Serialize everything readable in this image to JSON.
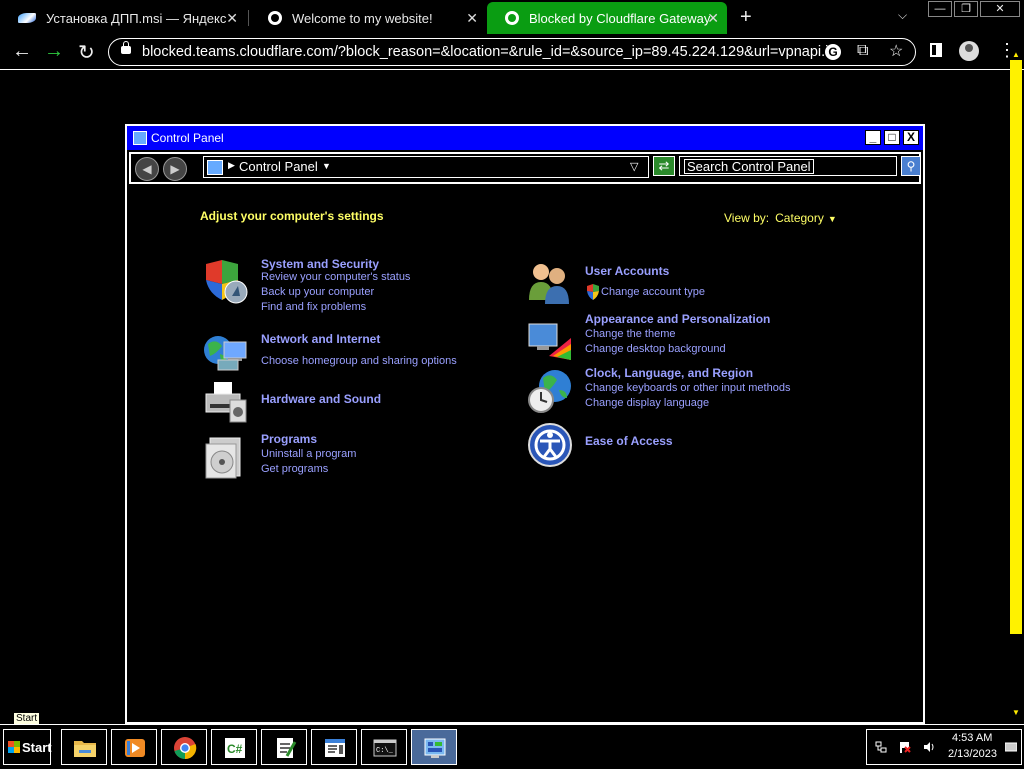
{
  "browser": {
    "tabs": [
      {
        "title": "Установка ДПП.msi — Яндекс.Д",
        "icon": "yandex-disk-icon",
        "active": false
      },
      {
        "title": "Welcome to my website!",
        "icon": "globe-icon",
        "active": false
      },
      {
        "title": "Blocked by Cloudflare Gateway",
        "icon": "globe-icon",
        "active": true
      }
    ],
    "new_tab": "+",
    "tab_close": "✕",
    "window_controls": {
      "minimize": "—",
      "restore": "❐",
      "close": "✕"
    },
    "url": "blocked.teams.cloudflare.com/?block_reason=&location=&rule_id=&source_ip=89.45.224.129&url=vpnapi.io",
    "google_letter": "G",
    "accent_active_tab": "#0a9d12"
  },
  "control_panel": {
    "window_title": "Control Panel",
    "window_buttons": {
      "minimize": "_",
      "maximize": "□",
      "close": "X"
    },
    "breadcrumb": "Control Panel",
    "search_placeholder": "Search Control Panel",
    "heading": "Adjust your computer's settings",
    "view_by_label": "View by:",
    "view_by_value": "Category",
    "categories": [
      {
        "title": "System and Security",
        "icon": "shield-icon",
        "links": [
          "Review your computer's status",
          "Back up your computer",
          "Find and fix problems"
        ]
      },
      {
        "title": "Network and Internet",
        "icon": "network-globe-icon",
        "links": [
          "Choose homegroup and sharing options"
        ]
      },
      {
        "title": "Hardware and Sound",
        "icon": "printer-icon",
        "links": []
      },
      {
        "title": "Programs",
        "icon": "programs-icon",
        "links": [
          "Uninstall a program",
          "Get programs"
        ]
      },
      {
        "title": "User Accounts",
        "icon": "users-icon",
        "links": [
          "Change account type"
        ]
      },
      {
        "title": "Appearance and Personalization",
        "icon": "monitor-palette-icon",
        "links": [
          "Change the theme",
          "Change desktop background"
        ]
      },
      {
        "title": "Clock, Language, and Region",
        "icon": "clock-globe-icon",
        "links": [
          "Change keyboards or other input methods",
          "Change display language"
        ]
      },
      {
        "title": "Ease of Access",
        "icon": "ease-of-access-icon",
        "links": []
      }
    ],
    "heading_color": "#ffff66",
    "link_color": "#9aa0ff",
    "title_bar_color": "#0000ff"
  },
  "taskbar": {
    "start_label": "Start",
    "start_tooltip": "Start",
    "pinned": [
      "file-explorer-icon",
      "media-player-icon",
      "chrome-icon",
      "csharp-icon",
      "notepad-icon",
      "reader-icon",
      "cmd-icon",
      "control-panel-icon"
    ],
    "time": "4:53 AM",
    "date": "2/13/2023"
  },
  "scrollbar_color": "#fff200"
}
